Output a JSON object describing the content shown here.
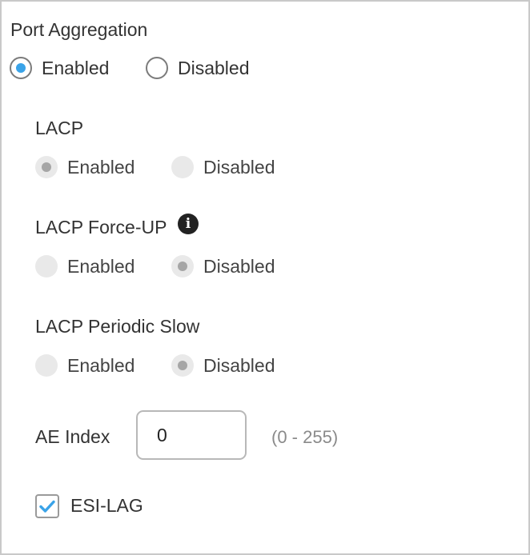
{
  "port_aggregation": {
    "title": "Port Aggregation",
    "enabled_label": "Enabled",
    "disabled_label": "Disabled",
    "selected": "Enabled"
  },
  "lacp": {
    "title": "LACP",
    "enabled_label": "Enabled",
    "disabled_label": "Disabled",
    "selected": "Enabled"
  },
  "lacp_force_up": {
    "title": "LACP Force-UP",
    "info_icon": "info-circle",
    "info_glyph": "i",
    "enabled_label": "Enabled",
    "disabled_label": "Disabled",
    "selected": "Disabled"
  },
  "lacp_periodic_slow": {
    "title": "LACP Periodic Slow",
    "enabled_label": "Enabled",
    "disabled_label": "Disabled",
    "selected": "Disabled"
  },
  "ae_index": {
    "label": "AE Index",
    "value": "0",
    "range_hint": "(0 - 255)"
  },
  "esi_lag": {
    "label": "ESI-LAG",
    "checked": true
  },
  "colors": {
    "accent": "#3aa3e8",
    "border": "#c9c9c9",
    "disabled_radio": "#e9e9e9",
    "hint_text": "#8a8a8a"
  }
}
